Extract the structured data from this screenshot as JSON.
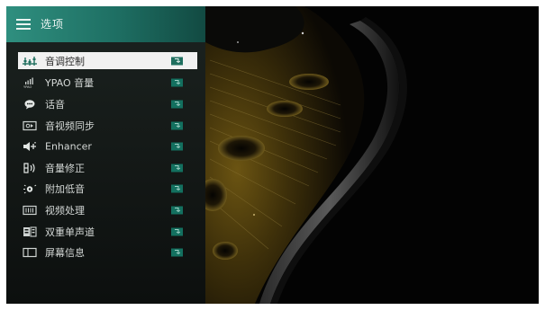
{
  "menu": {
    "title": "选项",
    "items": [
      {
        "label": "音调控制",
        "icon": "equalizer-icon",
        "selected": true
      },
      {
        "label": "YPAO 音量",
        "icon": "ypao-icon",
        "selected": false
      },
      {
        "label": "话音",
        "icon": "speech-bubble-icon",
        "selected": false
      },
      {
        "label": "音视频同步",
        "icon": "av-sync-icon",
        "selected": false
      },
      {
        "label": "Enhancer",
        "icon": "speaker-sparkle-icon",
        "selected": false
      },
      {
        "label": "音量修正",
        "icon": "volume-trim-icon",
        "selected": false
      },
      {
        "label": "附加低音",
        "icon": "subwoofer-icon",
        "selected": false
      },
      {
        "label": "视频处理",
        "icon": "video-processing-icon",
        "selected": false
      },
      {
        "label": "双重单声道",
        "icon": "dual-mono-icon",
        "selected": false
      },
      {
        "label": "屏幕信息",
        "icon": "screen-info-icon",
        "selected": false
      }
    ]
  },
  "colors": {
    "header_accent": "#2f8f7f",
    "enter_badge": "#13705f",
    "selected_row": "#f1f1f1"
  }
}
